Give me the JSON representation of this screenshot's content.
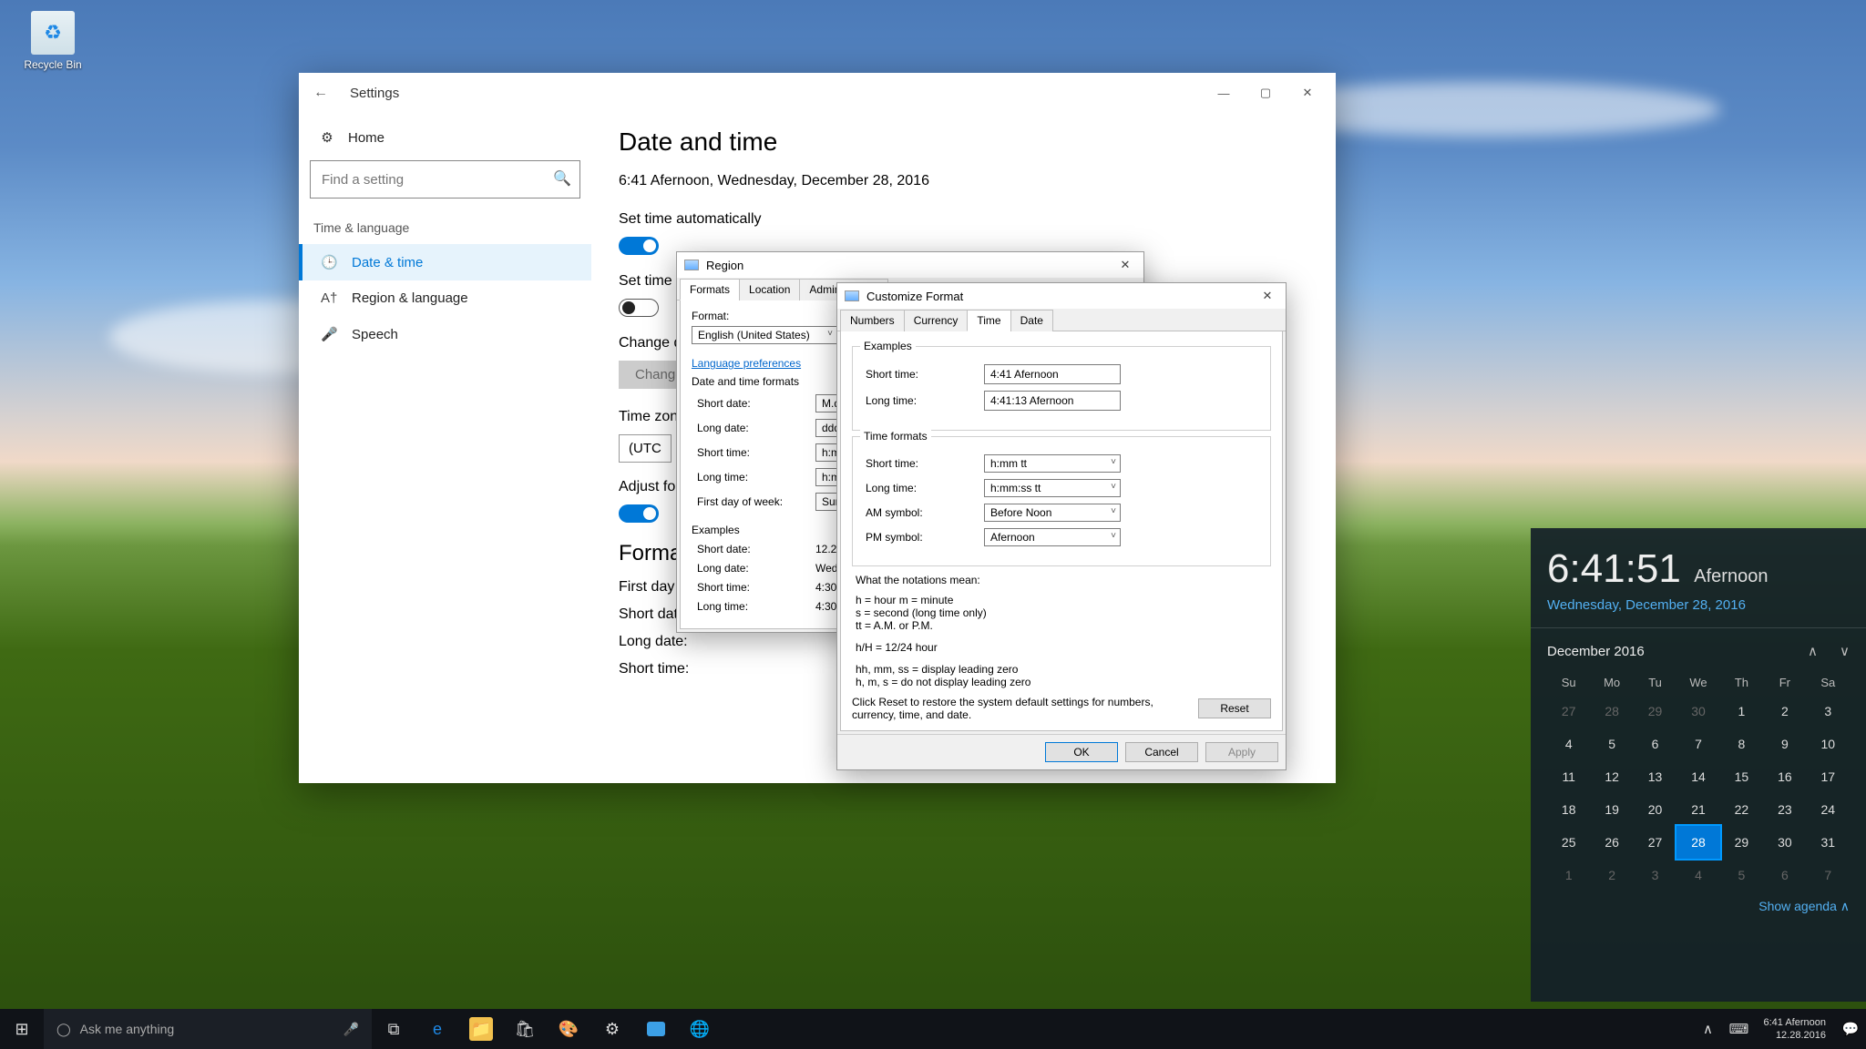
{
  "desktop": {
    "recycle_bin": "Recycle Bin"
  },
  "settings": {
    "title": "Settings",
    "home": "Home",
    "search_placeholder": "Find a setting",
    "category": "Time & language",
    "sidebar": [
      {
        "label": "Date & time",
        "icon": "🕒",
        "sel": true
      },
      {
        "label": "Region & language",
        "icon": "A†"
      },
      {
        "label": "Speech",
        "icon": "🎤"
      }
    ],
    "heading": "Date and time",
    "current": "6:41 Afernoon, Wednesday, December 28, 2016",
    "auto_time_label": "Set time automatically",
    "auto_tz_label": "Set time zone automatically",
    "change_label": "Change date and time",
    "change_btn": "Change",
    "tz_label": "Time zone",
    "tz_value": "(UTC",
    "dst_label": "Adjust for daylight saving time automatically",
    "formats_heading": "Formats",
    "rows": {
      "first_day": "First day of week:",
      "short_date": "Short date:",
      "long_date": "Long date:",
      "short_time": "Short time:"
    }
  },
  "region": {
    "title": "Region",
    "tabs": [
      "Formats",
      "Location",
      "Administrative"
    ],
    "format_label": "Format:",
    "format_value": "English (United States)",
    "lang_pref": "Language preferences",
    "section": "Date and time formats",
    "rows": {
      "short_date": {
        "k": "Short date:",
        "v": "M.d"
      },
      "long_date": {
        "k": "Long date:",
        "v": "ddd"
      },
      "short_time": {
        "k": "Short time:",
        "v": "h:m"
      },
      "long_time": {
        "k": "Long time:",
        "v": "h:m"
      },
      "first_dow": {
        "k": "First day of week:",
        "v": "Sun"
      }
    },
    "examples_label": "Examples",
    "examples": {
      "short_date": {
        "k": "Short date:",
        "v": "12.28"
      },
      "long_date": {
        "k": "Long date:",
        "v": "Wed"
      },
      "short_time": {
        "k": "Short time:",
        "v": "4:30"
      },
      "long_time": {
        "k": "Long time:",
        "v": "4:30"
      }
    }
  },
  "custom": {
    "title": "Customize Format",
    "tabs": [
      "Numbers",
      "Currency",
      "Time",
      "Date"
    ],
    "examples_label": "Examples",
    "ex_short": {
      "k": "Short time:",
      "v": "4:41 Afernoon"
    },
    "ex_long": {
      "k": "Long time:",
      "v": "4:41:13 Afernoon"
    },
    "tf_label": "Time formats",
    "tf_short": {
      "k": "Short time:",
      "v": "h:mm tt"
    },
    "tf_long": {
      "k": "Long time:",
      "v": "h:mm:ss tt"
    },
    "am": {
      "k": "AM symbol:",
      "v": "Before Noon"
    },
    "pm": {
      "k": "PM symbol:",
      "v": "Afernoon"
    },
    "notations_label": "What the notations mean:",
    "note1": "h = hour   m = minute",
    "note2": "s = second (long time only)",
    "note3": "tt = A.M. or P.M.",
    "note4": "h/H = 12/24 hour",
    "note5": "hh, mm, ss = display leading zero",
    "note6": "h, m, s = do not display leading zero",
    "reset_text": "Click Reset to restore the system default settings for numbers, currency, time, and date.",
    "reset": "Reset",
    "ok": "OK",
    "cancel": "Cancel",
    "apply": "Apply"
  },
  "flyout": {
    "time": "6:41:51",
    "ampm": "Afernoon",
    "date": "Wednesday, December 28, 2016",
    "month": "December 2016",
    "dow": [
      "Su",
      "Mo",
      "Tu",
      "We",
      "Th",
      "Fr",
      "Sa"
    ],
    "grid": [
      {
        "n": 27,
        "o": true
      },
      {
        "n": 28,
        "o": true
      },
      {
        "n": 29,
        "o": true
      },
      {
        "n": 30,
        "o": true
      },
      {
        "n": 1
      },
      {
        "n": 2
      },
      {
        "n": 3
      },
      {
        "n": 4
      },
      {
        "n": 5
      },
      {
        "n": 6
      },
      {
        "n": 7
      },
      {
        "n": 8
      },
      {
        "n": 9
      },
      {
        "n": 10
      },
      {
        "n": 11
      },
      {
        "n": 12
      },
      {
        "n": 13
      },
      {
        "n": 14
      },
      {
        "n": 15
      },
      {
        "n": 16
      },
      {
        "n": 17
      },
      {
        "n": 18
      },
      {
        "n": 19
      },
      {
        "n": 20
      },
      {
        "n": 21
      },
      {
        "n": 22
      },
      {
        "n": 23
      },
      {
        "n": 24
      },
      {
        "n": 25
      },
      {
        "n": 26
      },
      {
        "n": 27
      },
      {
        "n": 28,
        "t": true
      },
      {
        "n": 29
      },
      {
        "n": 30
      },
      {
        "n": 31
      },
      {
        "n": 1,
        "o": true
      },
      {
        "n": 2,
        "o": true
      },
      {
        "n": 3,
        "o": true
      },
      {
        "n": 4,
        "o": true
      },
      {
        "n": 5,
        "o": true
      },
      {
        "n": 6,
        "o": true
      },
      {
        "n": 7,
        "o": true
      }
    ],
    "agenda": "Show agenda  ∧"
  },
  "taskbar": {
    "cortana": "Ask me anything",
    "tray_time": "6:41 Afernoon",
    "tray_date": "12.28.2016"
  }
}
